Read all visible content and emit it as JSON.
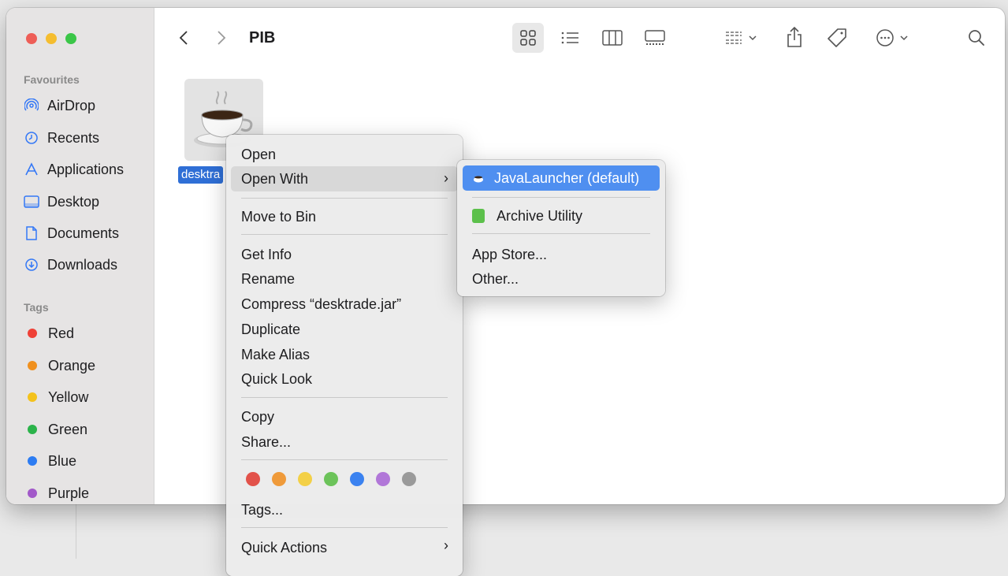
{
  "window": {
    "path_title": "PIB"
  },
  "sidebar": {
    "favourites_heading": "Favourites",
    "favourites": [
      {
        "label": "AirDrop",
        "icon": "airdrop-icon"
      },
      {
        "label": "Recents",
        "icon": "clock-icon"
      },
      {
        "label": "Applications",
        "icon": "applications-icon"
      },
      {
        "label": "Desktop",
        "icon": "desktop-icon"
      },
      {
        "label": "Documents",
        "icon": "document-icon"
      },
      {
        "label": "Downloads",
        "icon": "download-icon"
      }
    ],
    "tags_heading": "Tags",
    "tags": [
      {
        "label": "Red",
        "color": "#ef4137"
      },
      {
        "label": "Orange",
        "color": "#f0901e"
      },
      {
        "label": "Yellow",
        "color": "#f4c21c"
      },
      {
        "label": "Green",
        "color": "#2bb34a"
      },
      {
        "label": "Blue",
        "color": "#2d7cf2"
      },
      {
        "label": "Purple",
        "color": "#a259c9"
      }
    ]
  },
  "file": {
    "name_visible": "desktra"
  },
  "context_menu": {
    "open": "Open",
    "open_with": "Open With",
    "move_to_bin": "Move to Bin",
    "get_info": "Get Info",
    "rename": "Rename",
    "compress": "Compress “desktrade.jar”",
    "duplicate": "Duplicate",
    "make_alias": "Make Alias",
    "quick_look": "Quick Look",
    "copy": "Copy",
    "share": "Share...",
    "tags": "Tags...",
    "quick_actions": "Quick Actions",
    "tag_colors": [
      "#e2524a",
      "#ef9a3a",
      "#f3d047",
      "#6cc35a",
      "#3b82f0",
      "#b177d8",
      "#9a9a9a"
    ]
  },
  "submenu": {
    "java_launcher": "JavaLauncher (default)",
    "archive_utility": "Archive Utility",
    "app_store": "App Store...",
    "other": "Other..."
  }
}
